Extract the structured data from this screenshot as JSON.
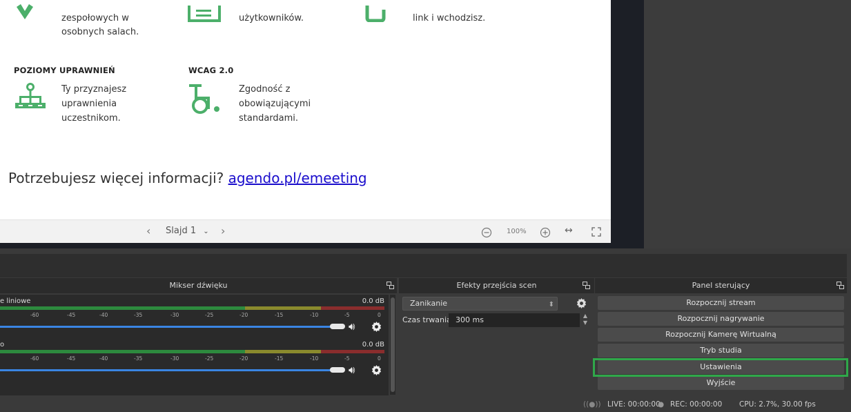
{
  "slide": {
    "features": [
      {
        "lines": [
          "zespołowych w",
          "osobnych salach."
        ]
      },
      {
        "lines": [
          "użytkowników."
        ]
      },
      {
        "lines": [
          "link i wchodzisz."
        ]
      }
    ],
    "section2": [
      {
        "heading": "POZIOMY UPRAWNIEŃ",
        "lines": [
          "Ty przyznajesz",
          "uprawnienia",
          "uczestnikom."
        ]
      },
      {
        "heading": "WCAG 2.0",
        "lines": [
          "Zgodność z",
          "obowiązującymi",
          "standardami."
        ]
      }
    ],
    "footer_text": "Potrzebujesz więcej informacji? ",
    "footer_link": "agendo.pl/emeeting",
    "accent_color": "#4caf6a"
  },
  "slide_toolbar": {
    "slide_label": "Slajd 1",
    "zoom": "100%"
  },
  "mixer": {
    "title": "Mikser dźwięku",
    "channels": [
      {
        "name": "e liniowe",
        "db": "0.0 dB"
      },
      {
        "name": "o",
        "db": "0.0 dB"
      }
    ],
    "tick_labels": [
      "-60",
      "-45",
      "-40",
      "-35",
      "-30",
      "-25",
      "-20",
      "-15",
      "-10",
      "-5",
      "0"
    ]
  },
  "transitions": {
    "title": "Efekty przejścia scen",
    "selected": "Zanikanie",
    "duration_label": "Czas trwania",
    "duration_value": "300 ms"
  },
  "controls": {
    "title": "Panel sterujący",
    "buttons": [
      "Rozpocznij stream",
      "Rozpocznij nagrywanie",
      "Rozpocznij Kamerę Wirtualną",
      "Tryb studia",
      "Ustawienia",
      "Wyjście"
    ]
  },
  "status": {
    "live": "LIVE: 00:00:00",
    "rec": "REC: 00:00:00",
    "cpu": "CPU: 2.7%, 30.00 fps"
  }
}
